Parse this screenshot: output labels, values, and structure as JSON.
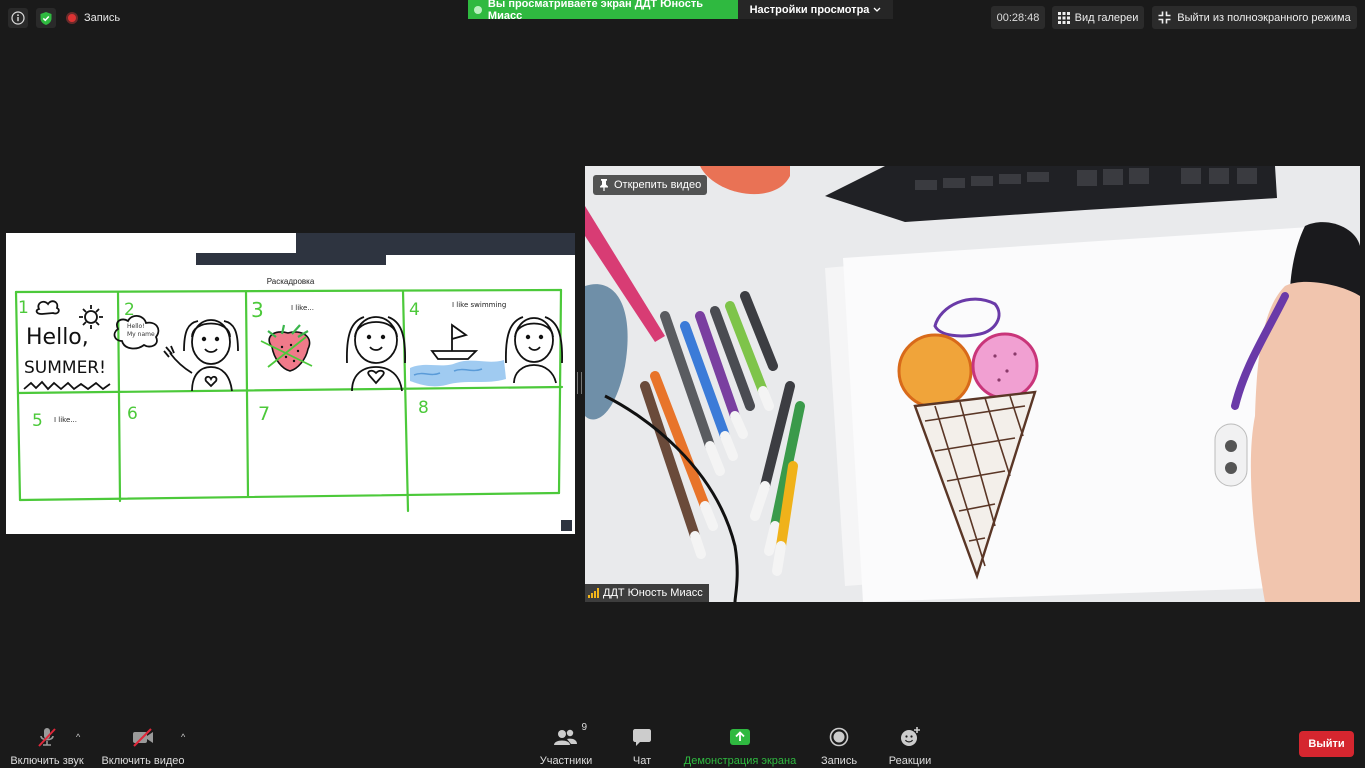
{
  "topbar": {
    "record_label": "Запись",
    "share_banner": "Вы просматриваете экран ДДТ Юность Миасс",
    "view_settings": "Настройки просмотра",
    "timer": "00:28:48",
    "gallery_view": "Вид галереи",
    "exit_fullscreen": "Выйти из полноэкранного режима"
  },
  "shared_screen": {
    "title": "Раскадровка",
    "cells": [
      {
        "num": "1",
        "caption": "",
        "art": "Hello, SUMMER!"
      },
      {
        "num": "2",
        "caption": "",
        "art": "Hello! My name"
      },
      {
        "num": "3",
        "caption": "I like...",
        "art": ""
      },
      {
        "num": "4",
        "caption": "I like swimming",
        "art": ""
      },
      {
        "num": "5",
        "caption": "I like...",
        "art": ""
      },
      {
        "num": "6",
        "caption": "",
        "art": ""
      },
      {
        "num": "7",
        "caption": "",
        "art": ""
      },
      {
        "num": "8",
        "caption": "",
        "art": ""
      }
    ]
  },
  "video": {
    "pin_label": "Открепить видео",
    "participant_name": "ДДТ Юность Миасс"
  },
  "toolbar": {
    "unmute": "Включить звук",
    "start_video": "Включить видео",
    "participants": "Участники",
    "participants_count": "9",
    "chat": "Чат",
    "share_screen": "Демонстрация экрана",
    "record": "Запись",
    "reactions": "Реакции",
    "leave": "Выйти"
  },
  "colors": {
    "share_green": "#2fb940",
    "leave_red": "#d5262f",
    "storyboard_green": "#4cc93a"
  }
}
